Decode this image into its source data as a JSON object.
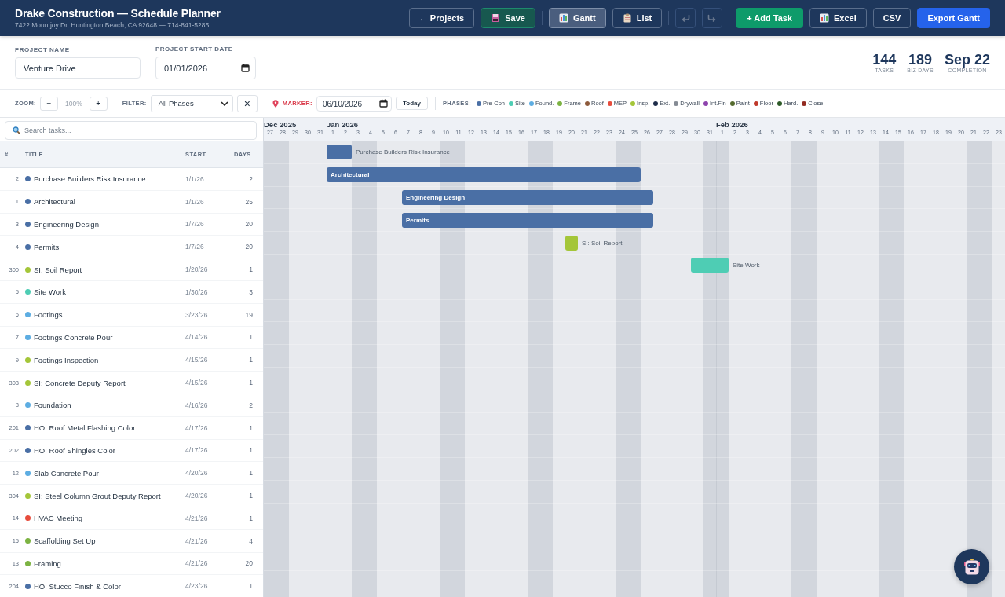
{
  "header": {
    "title": "Drake Construction — Schedule Planner",
    "subtitle": "7422 Mountjoy Dr, Huntington Beach, CA 92648 — 714-841-5285",
    "buttons": [
      {
        "kind": "back",
        "label": "← Projects"
      },
      {
        "kind": "save",
        "label": "Save"
      },
      {
        "kind": "divider"
      },
      {
        "kind": "gantt",
        "label": "Gantt",
        "selected": true
      },
      {
        "kind": "list",
        "label": "List",
        "selected": false
      },
      {
        "kind": "divider"
      },
      {
        "kind": "undo",
        "disabled": true
      },
      {
        "kind": "redo",
        "disabled": true
      },
      {
        "kind": "divider"
      },
      {
        "kind": "add",
        "label": "+ Add Task"
      },
      {
        "kind": "excel",
        "label": "Excel"
      },
      {
        "kind": "csv",
        "label": "CSV"
      },
      {
        "kind": "primary",
        "label": "Export Gantt"
      }
    ]
  },
  "project": {
    "name_label": "PROJECT NAME",
    "name": "Venture Drive",
    "start_label": "PROJECT START DATE",
    "start_date": "01/01/2026",
    "stats": [
      {
        "value": "144",
        "label": "TASKS"
      },
      {
        "value": "189",
        "label": "BIZ DAYS"
      },
      {
        "value": "Sep 22",
        "label": "COMPLETION"
      }
    ]
  },
  "toolbar": {
    "zoom_label": "ZOOM:",
    "zoom_out": "−",
    "zoom_value": "100%",
    "zoom_in": "+",
    "filter_label": "FILTER:",
    "filter": "All Phases",
    "clear": "×",
    "marker_label": "MARKER:",
    "marker_date": "06/10/2026",
    "today": "Today",
    "phases_label": "PHASES:",
    "phases": [
      {
        "label": "Pre-Con",
        "color": "#4a6fa5"
      },
      {
        "label": "Site",
        "color": "#4ecdb4"
      },
      {
        "label": "Found.",
        "color": "#5dade2"
      },
      {
        "label": "Frame",
        "color": "#7cb342"
      },
      {
        "label": "Roof",
        "color": "#8d5a3b"
      },
      {
        "label": "MEP",
        "color": "#e74c3c"
      },
      {
        "label": "Insp.",
        "color": "#a4c639"
      },
      {
        "label": "Ext.",
        "color": "#1e2d4a"
      },
      {
        "label": "Drywall",
        "color": "#858b94"
      },
      {
        "label": "Int.Fin",
        "color": "#8e44ad"
      },
      {
        "label": "Paint",
        "color": "#556b2f"
      },
      {
        "label": "Floor",
        "color": "#c0392b"
      },
      {
        "label": "Hard.",
        "color": "#2d5a27"
      },
      {
        "label": "Close",
        "color": "#922b21"
      }
    ]
  },
  "search": {
    "placeholder": "Search tasks..."
  },
  "table": {
    "columns": [
      "#",
      "TITLE",
      "START",
      "DAYS"
    ],
    "rows": [
      {
        "number": "2",
        "title": "Purchase Builders Risk Insurance",
        "start": "1/1/26",
        "days": "2",
        "color": "#4a6fa5",
        "bar": {
          "label": "Purchase Builders Risk Insurance",
          "label_inside": false
        }
      },
      {
        "number": "1",
        "title": "Architectural",
        "start": "1/1/26",
        "days": "25",
        "color": "#4a6fa5",
        "bar": {
          "label": "Architectural",
          "label_inside": true
        }
      },
      {
        "number": "3",
        "title": "Engineering Design",
        "start": "1/7/26",
        "days": "20",
        "color": "#4a6fa5",
        "bar": {
          "label": "Engineering Design",
          "label_inside": true
        }
      },
      {
        "number": "4",
        "title": "Permits",
        "start": "1/7/26",
        "days": "20",
        "color": "#4a6fa5",
        "bar": {
          "label": "Permits",
          "label_inside": true
        }
      },
      {
        "number": "300",
        "title": "SI: Soil Report",
        "start": "1/20/26",
        "days": "1",
        "color": "#a4c639",
        "bar": {
          "label": "SI: Soil Report",
          "label_inside": false
        }
      },
      {
        "number": "5",
        "title": "Site Work",
        "start": "1/30/26",
        "days": "3",
        "color": "#4ecdb4",
        "bar": {
          "label": "Site Work",
          "label_inside": false
        }
      },
      {
        "number": "6",
        "title": "Footings",
        "start": "3/23/26",
        "days": "19",
        "color": "#5dade2"
      },
      {
        "number": "7",
        "title": "Footings Concrete Pour",
        "start": "4/14/26",
        "days": "1",
        "color": "#5dade2"
      },
      {
        "number": "9",
        "title": "Footings Inspection",
        "start": "4/15/26",
        "days": "1",
        "color": "#a4c639"
      },
      {
        "number": "303",
        "title": "SI: Concrete Deputy Report",
        "start": "4/15/26",
        "days": "1",
        "color": "#a4c639"
      },
      {
        "number": "8",
        "title": "Foundation",
        "start": "4/16/26",
        "days": "2",
        "color": "#5dade2"
      },
      {
        "number": "201",
        "title": "HO: Roof Metal Flashing Color",
        "start": "4/17/26",
        "days": "1",
        "color": "#4a6fa5"
      },
      {
        "number": "202",
        "title": "HO: Roof Shingles Color",
        "start": "4/17/26",
        "days": "1",
        "color": "#4a6fa5"
      },
      {
        "number": "12",
        "title": "Slab Concrete Pour",
        "start": "4/20/26",
        "days": "1",
        "color": "#5dade2"
      },
      {
        "number": "304",
        "title": "SI: Steel Column Grout Deputy Report",
        "start": "4/20/26",
        "days": "1",
        "color": "#a4c639"
      },
      {
        "number": "14",
        "title": "HVAC Meeting",
        "start": "4/21/26",
        "days": "1",
        "color": "#e74c3c"
      },
      {
        "number": "15",
        "title": "Scaffolding Set Up",
        "start": "4/21/26",
        "days": "4",
        "color": "#7cb342"
      },
      {
        "number": "13",
        "title": "Framing",
        "start": "4/21/26",
        "days": "20",
        "color": "#7cb342"
      },
      {
        "number": "204",
        "title": "HO: Stucco Finish & Color",
        "start": "4/23/26",
        "days": "1",
        "color": "#4a6fa5"
      }
    ]
  },
  "timeline": {
    "months": [
      {
        "label": "Dec 2025",
        "days": [
          {
            "label": "27"
          },
          {
            "label": "28"
          },
          {
            "label": "29"
          },
          {
            "label": "30"
          },
          {
            "label": "31"
          }
        ]
      },
      {
        "label": "Jan 2026",
        "days": [
          {
            "label": "1"
          },
          {
            "label": "2"
          },
          {
            "label": "3"
          },
          {
            "label": "4"
          },
          {
            "label": "5"
          },
          {
            "label": "6"
          },
          {
            "label": "7"
          },
          {
            "label": "8"
          },
          {
            "label": "9"
          },
          {
            "label": "10"
          },
          {
            "label": "11"
          },
          {
            "label": "12"
          },
          {
            "label": "13"
          },
          {
            "label": "14"
          },
          {
            "label": "15"
          },
          {
            "label": "16"
          },
          {
            "label": "17"
          },
          {
            "label": "18"
          },
          {
            "label": "19"
          },
          {
            "label": "20"
          },
          {
            "label": "21"
          },
          {
            "label": "22"
          },
          {
            "label": "23"
          },
          {
            "label": "24"
          },
          {
            "label": "25"
          },
          {
            "label": "26"
          },
          {
            "label": "27"
          },
          {
            "label": "28"
          },
          {
            "label": "29"
          },
          {
            "label": "30"
          },
          {
            "label": "31"
          }
        ]
      },
      {
        "label": "Feb 2026",
        "days": [
          {
            "label": "1"
          },
          {
            "label": "2"
          },
          {
            "label": "3"
          },
          {
            "label": "4"
          },
          {
            "label": "5"
          },
          {
            "label": "6"
          },
          {
            "label": "7"
          },
          {
            "label": "8"
          },
          {
            "label": "9"
          },
          {
            "label": "10"
          },
          {
            "label": "11"
          },
          {
            "label": "12"
          },
          {
            "label": "13"
          },
          {
            "label": "14"
          },
          {
            "label": "15"
          },
          {
            "label": "16"
          },
          {
            "label": "17"
          },
          {
            "label": "18"
          },
          {
            "label": "19"
          },
          {
            "label": "20"
          },
          {
            "label": "21"
          },
          {
            "label": "22"
          },
          {
            "label": "23"
          }
        ]
      }
    ]
  },
  "assistant": {
    "kind": "robot"
  }
}
